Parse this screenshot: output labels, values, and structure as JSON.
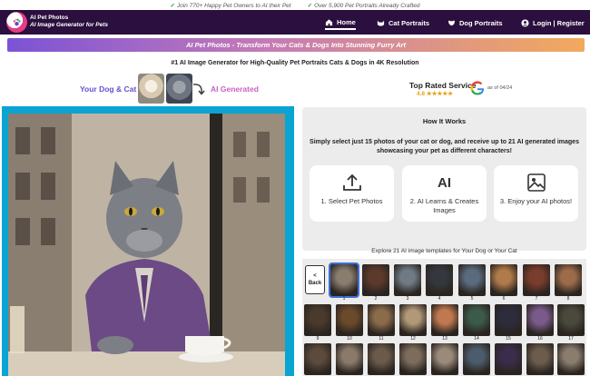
{
  "topbar": {
    "msg1": "Join 770+ Happy Pet Owners to AI their Pet",
    "msg2": "Over 5,900 Pet Portraits Already Crafted"
  },
  "brand": {
    "name": "AI Pet Photos",
    "tagline": "AI Image Generator for Pets"
  },
  "nav": {
    "home": "Home",
    "cat": "Cat Portraits",
    "dog": "Dog Portraits",
    "login": "Login | Register"
  },
  "banner": "AI Pet Photos - Transform Your Cats & Dogs Into Stunning Furry Art",
  "headline": "#1 AI Image Generator for High-Quality Pet Portraits Cats & Dogs in 4K Resolution",
  "compare": {
    "left": "Your Dog & Cat",
    "right": "AI Generated"
  },
  "rating": {
    "title": "Top Rated Service",
    "score": "4.8 ★★★★★",
    "asof": "as of 04/24"
  },
  "how": {
    "title": "How It Works",
    "desc": "Simply select just 15 photos of your cat or dog, and receive up to 21 AI generated images showcasing your pet as different characters!",
    "steps": [
      {
        "label": "1. Select Pet Photos",
        "icon": "upload-icon"
      },
      {
        "label": "2. AI Learns & Creates Images",
        "icon": "ai-icon",
        "icon_text": "AI"
      },
      {
        "label": "3. Enjoy your AI photos!",
        "icon": "image-icon"
      }
    ]
  },
  "explore": "Explore 21 AI image templates for Your Dog or Your Cat",
  "back_label": [
    "<",
    "Back"
  ],
  "templates": {
    "numbers": [
      "1",
      "2",
      "3",
      "4",
      "5",
      "6",
      "7",
      "8",
      "9",
      "10",
      "11",
      "12",
      "13",
      "14",
      "15",
      "16",
      "17"
    ],
    "colors": [
      "#8a7d6e",
      "#5b3a2c",
      "#6f7a84",
      "#34383d",
      "#5a6b7d",
      "#b07a4a",
      "#7a3c2c",
      "#9c6b4a",
      "#4a3a2c",
      "#6b4a2c",
      "#8a6b4a",
      "#b09878",
      "#c07850",
      "#3c5a4a",
      "#2c2c3c",
      "#7a5a8a",
      "#4a4a3c",
      "#5c4a3c",
      "#8a7a6a",
      "#6a5a4a",
      "#7c6c5c",
      "#9a8a7a",
      "#4c5c6c",
      "#3a2c4a",
      "#6c5c4c"
    ],
    "selected_index": 0
  },
  "colors": {
    "nav_bg": "#2b0f3e",
    "hero_frame": "#0aa4d3",
    "purple_text": "#6a4fcf",
    "pink_text": "#c862c4"
  }
}
